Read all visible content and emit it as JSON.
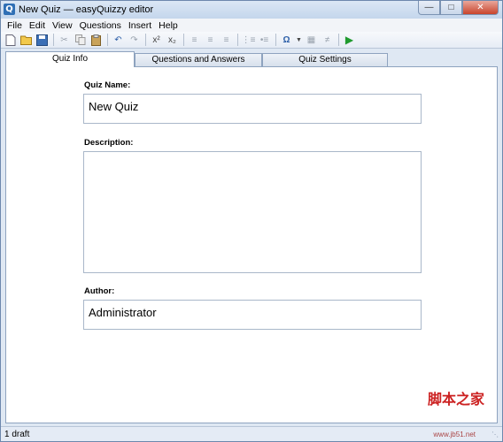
{
  "window": {
    "title": "New Quiz — easyQuizzy editor",
    "icon_letter": "Q"
  },
  "menu": [
    "File",
    "Edit",
    "View",
    "Questions",
    "Insert",
    "Help"
  ],
  "tabs": [
    {
      "label": "Quiz Info",
      "active": true
    },
    {
      "label": "Questions and Answers",
      "active": false
    },
    {
      "label": "Quiz Settings",
      "active": false
    }
  ],
  "form": {
    "quiz_name_label": "Quiz Name:",
    "quiz_name_value": "New Quiz",
    "description_label": "Description:",
    "description_value": "",
    "author_label": "Author:",
    "author_value": "Administrator"
  },
  "status": {
    "text": "1 draft"
  },
  "watermark": {
    "text": "脚本之家",
    "url": "www.jb51.net"
  }
}
